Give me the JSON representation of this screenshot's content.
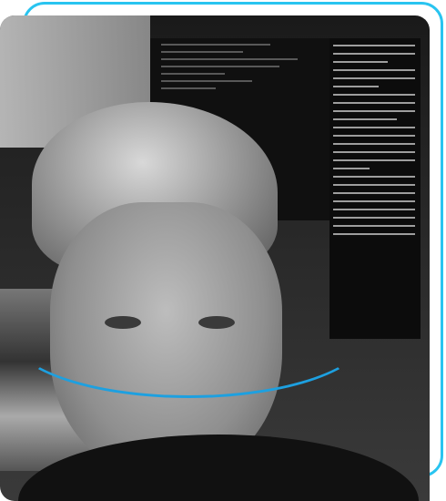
{
  "image": {
    "subject": "photo",
    "accent_color": "#29c4f0",
    "arc_color": "#1da0e0"
  }
}
